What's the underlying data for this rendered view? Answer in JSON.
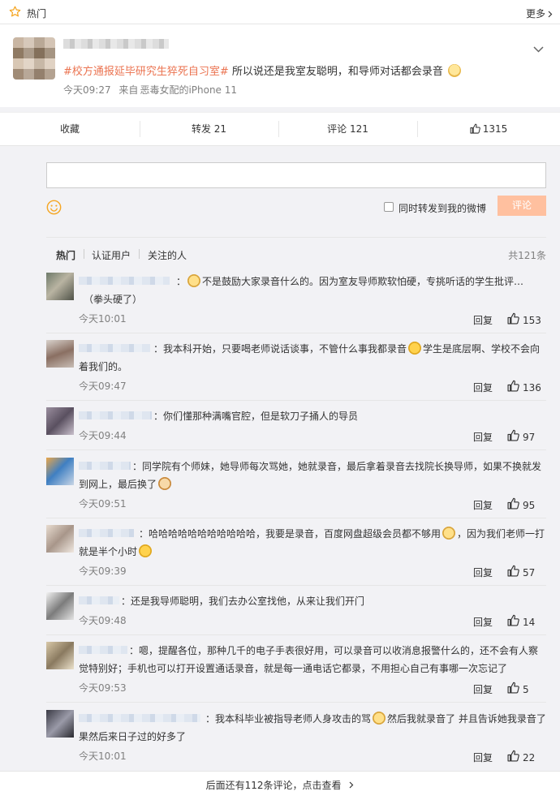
{
  "header": {
    "hot_label": "热门",
    "more_label": "更多"
  },
  "post": {
    "topic": "#校方通报延毕研究生猝死自习室#",
    "text": " 所以说还是我室友聪明，和导师对话都会录音",
    "time": "今天09:27",
    "source_prefix": "来自",
    "source": "恶毒女配的iPhone 11"
  },
  "actions": {
    "favorite": "收藏",
    "repost": "转发 21",
    "comment": "评论 121",
    "like": "1315"
  },
  "composer": {
    "repost_checkbox_label": "同时转发到我的微博",
    "submit_label": "评论"
  },
  "filters": {
    "tabs": [
      "热门",
      "认证用户",
      "关注的人"
    ],
    "total": "共121条"
  },
  "comments": [
    {
      "sep": "：",
      "text_a": "不是鼓励大家录音什么的。因为室友导师欺软怕硬，专挑听话的学生批评…",
      "text_b": "（拳头硬了）",
      "time": "今天10:01",
      "reply": "回复",
      "likes": "153"
    },
    {
      "sep": "：",
      "text_a": "我本科开始，只要喝老师说话谈事，不管什么事我都录音",
      "text_b": "学生是底层啊、学校不会向着我们的。",
      "time": "今天09:47",
      "reply": "回复",
      "likes": "136"
    },
    {
      "sep": "：",
      "text_a": "你们懂那种满嘴官腔，但是软刀子捅人的导员",
      "time": "今天09:44",
      "reply": "回复",
      "likes": "97"
    },
    {
      "sep": "：",
      "text_a": "同学院有个师妹，她导师每次骂她，她就录音，最后拿着录音去找院长换导师，如果不换就发到网上，最后换了",
      "time": "今天09:51",
      "reply": "回复",
      "likes": "95"
    },
    {
      "sep": "：",
      "text_a": "哈哈哈哈哈哈哈哈哈哈哈，我要是录音，百度网盘超级会员都不够用",
      "text_b": "，因为我们老师一打就是半个小时",
      "time": "今天09:39",
      "reply": "回复",
      "likes": "57"
    },
    {
      "sep": "：",
      "text_a": "还是我导师聪明，我们去办公室找他，从来让我们开门",
      "time": "今天09:48",
      "reply": "回复",
      "likes": "14"
    },
    {
      "sep": "：",
      "text_a": "嗯，提醒各位，那种几千的电子手表很好用，可以录音可以收消息报警什么的，还不会有人察觉特别好；手机也可以打开设置通话录音，就是每一通电话它都录，不用担心自己有事哪一次忘记了",
      "time": "今天09:53",
      "reply": "回复",
      "likes": "5"
    },
    {
      "sep": "：",
      "text_a": "我本科毕业被指导老师人身攻击的骂",
      "text_b": "然后我就录音了 并且告诉她我录音了 果然后来日子过的好多了",
      "time": "今天10:01",
      "reply": "回复",
      "likes": "22"
    }
  ],
  "footer": {
    "more_comments": "后面还有112条评论，点击查看"
  },
  "colors": {
    "topic": "#eb7350",
    "submit_disabled": "#ffc09f",
    "text": "#333333",
    "muted": "#808080"
  }
}
